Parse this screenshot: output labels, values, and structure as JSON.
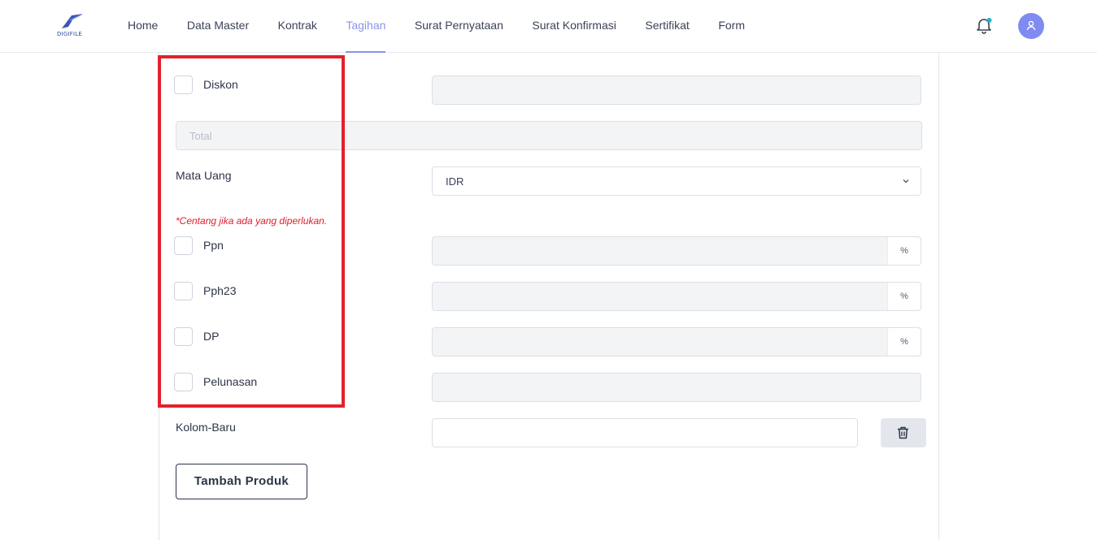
{
  "header": {
    "logo_text": "DIGIFILE",
    "nav": [
      {
        "label": "Home",
        "active": false
      },
      {
        "label": "Data Master",
        "active": false
      },
      {
        "label": "Kontrak",
        "active": false
      },
      {
        "label": "Tagihan",
        "active": true
      },
      {
        "label": "Surat Pernyataan",
        "active": false
      },
      {
        "label": "Surat Konfirmasi",
        "active": false
      },
      {
        "label": "Sertifikat",
        "active": false
      },
      {
        "label": "Form",
        "active": false
      }
    ],
    "icons": {
      "notification": "bell-icon",
      "profile": "user-icon"
    },
    "accent_color": "#8b93e6",
    "avatar_color": "#7f8bf0",
    "notification_dot_color": "#1fb6c9"
  },
  "form": {
    "diskon": {
      "label": "Diskon",
      "checked": false,
      "value": ""
    },
    "total": {
      "placeholder": "Total",
      "value": ""
    },
    "mata_uang": {
      "label": "Mata Uang",
      "value": "IDR"
    },
    "note": "*Centang jika ada yang diperlukan.",
    "ppn": {
      "label": "Ppn",
      "checked": false,
      "value": "",
      "suffix": "%"
    },
    "pph23": {
      "label": "Pph23",
      "checked": false,
      "value": "",
      "suffix": "%"
    },
    "dp": {
      "label": "DP",
      "checked": false,
      "value": "",
      "suffix": "%"
    },
    "pelunasan": {
      "label": "Pelunasan",
      "checked": false,
      "value": ""
    },
    "kolom_baru": {
      "label": "Kolom-Baru",
      "value": ""
    },
    "add_button": "Tambah Produk",
    "highlight_color": "#e3202d"
  }
}
